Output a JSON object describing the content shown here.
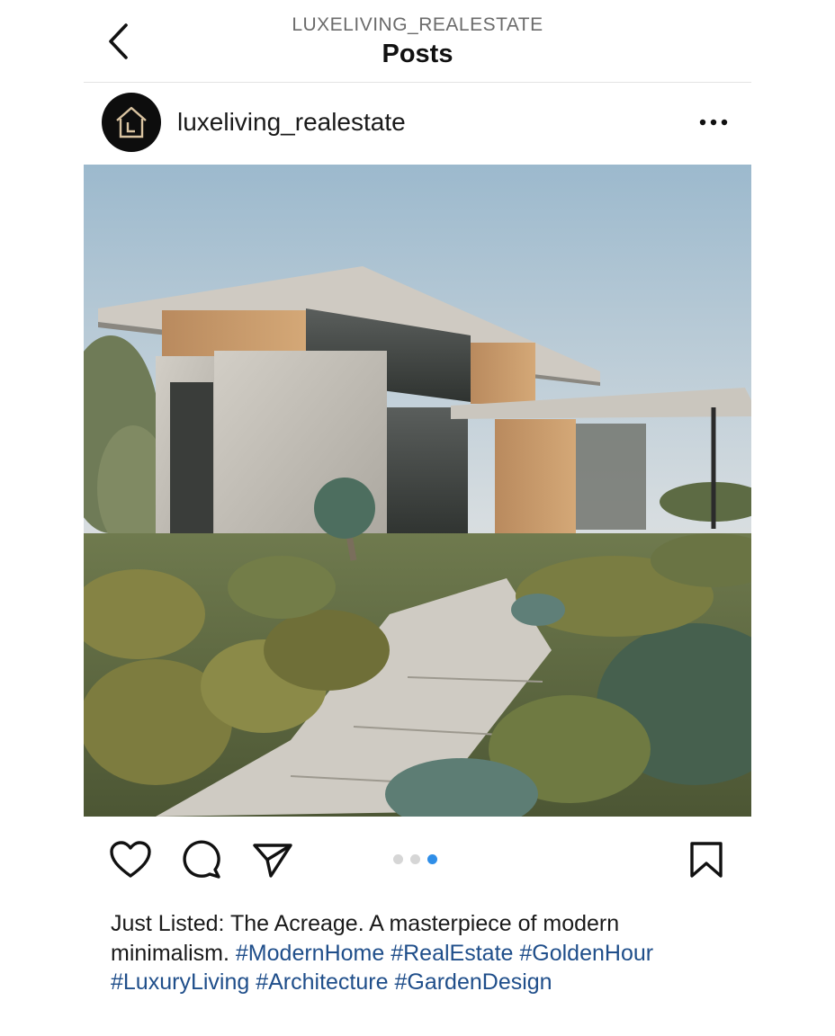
{
  "header": {
    "account_handle": "LUXELIVING_REALESTATE",
    "title": "Posts",
    "back_icon": "chevron-left-icon"
  },
  "post": {
    "username": "luxeliving_realestate",
    "avatar_icon": "house-logo-icon",
    "more_icon": "more-horizontal-icon",
    "image_subject": "modern-house-photo",
    "carousel": {
      "total": 3,
      "active": 3
    },
    "actions": {
      "like_icon": "heart-icon",
      "comment_icon": "comment-icon",
      "share_icon": "send-icon",
      "save_icon": "bookmark-icon"
    },
    "caption": {
      "line1": "Just Listed: The Acreage. A masterpiece of modern",
      "line2_text": "minimalism.",
      "line2_tags": [
        "#ModernHome",
        "#RealEstate",
        "#GoldenHour"
      ],
      "line3_tags": [
        "#LuxuryLiving",
        "#Architecture",
        "#GardenDesign"
      ]
    }
  },
  "colors": {
    "hashtag": "#1f4e8a",
    "carousel_active": "#2f8ee8",
    "carousel_inactive": "#d6d6d6",
    "avatar_bg": "#0d0d0d"
  }
}
